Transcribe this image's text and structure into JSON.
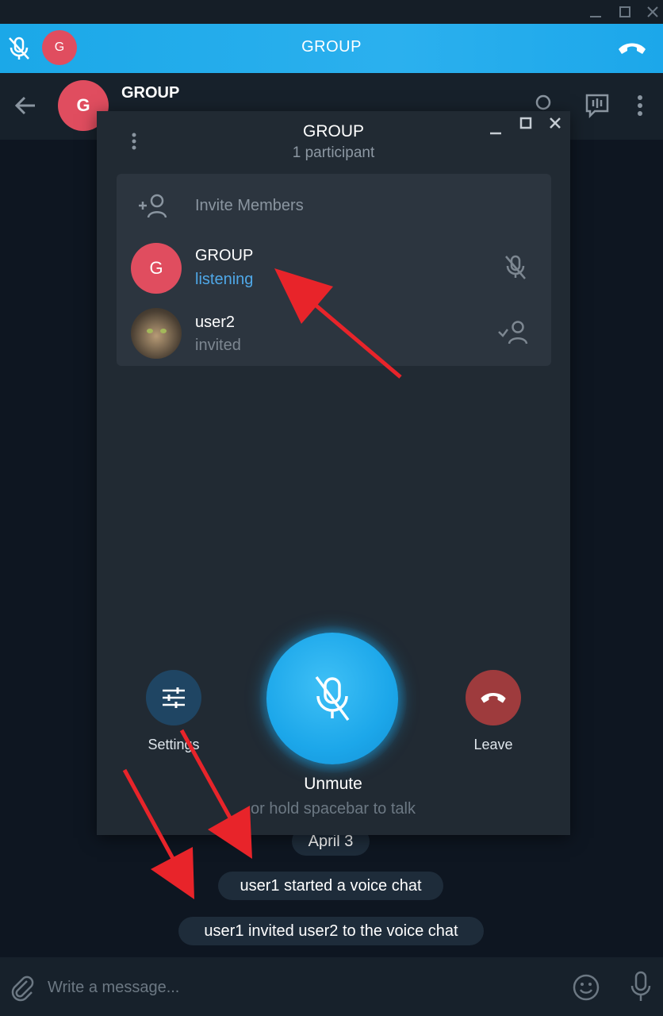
{
  "callbar": {
    "title": "GROUP",
    "avatar_letter": "G"
  },
  "header": {
    "title": "GROUP",
    "avatar_letter": "G"
  },
  "voice_panel": {
    "title": "GROUP",
    "subtitle": "1 participant",
    "invite_label": "Invite Members",
    "participants": [
      {
        "name": "GROUP",
        "status": "listening",
        "avatar_letter": "G",
        "status_color": "#4fa8e8"
      },
      {
        "name": "user2",
        "status": "invited",
        "status_color": "#7d8791"
      }
    ],
    "settings_label": "Settings",
    "leave_label": "Leave",
    "unmute_label": "Unmute",
    "unmute_hint": "or hold spacebar to talk"
  },
  "messages": {
    "date": "April 3",
    "service": [
      "user1 started a voice chat",
      "user1 invited user2 to the voice chat"
    ]
  },
  "composer": {
    "placeholder": "Write a message..."
  },
  "colors": {
    "accent": "#1ca7ea",
    "avatar_red": "#e04d5f",
    "leave_red": "#9e3b3d",
    "annotation_arrow": "#e8242a"
  },
  "icons": [
    "mic-off-icon",
    "end-call-icon",
    "back-arrow-icon",
    "search-icon",
    "voice-chat-icon",
    "more-vertical-icon",
    "minimize-icon",
    "maximize-icon",
    "close-icon",
    "add-user-icon",
    "check-user-icon",
    "settings-sliders-icon",
    "paperclip-icon",
    "emoji-icon",
    "microphone-icon"
  ]
}
